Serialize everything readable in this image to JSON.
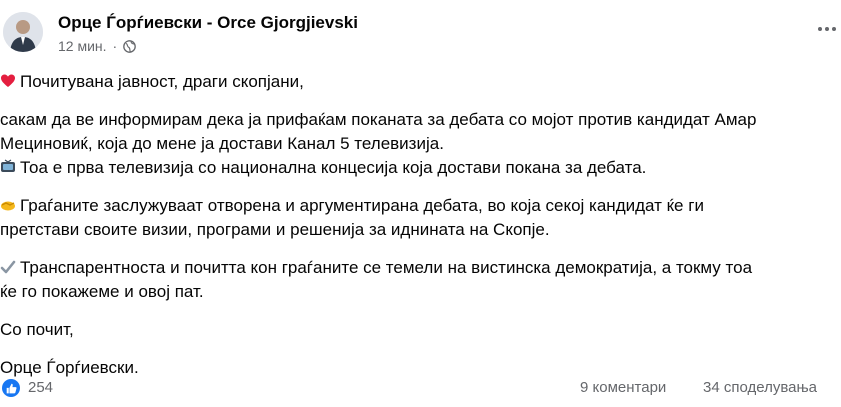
{
  "post": {
    "author": "Орце Ѓорѓиевски - Orce Gjorgjievski",
    "time": "12 мин.",
    "privacy_icon": "globe-icon",
    "more_icon": "more-options-icon",
    "body": {
      "p1": "Почитувана јавност, драги скопјани,",
      "p2": "сакам да ве информирам дека ја прифаќам поканата за дебата со мојот против кандидат Амар\nМециновиќ, која до мене ја достави Канал 5 телевизија.",
      "p2b": "Тоа е прва телевизија со национална концесија која достави покана за дебата.",
      "p3": "Граѓаните заслужуваат отворена и аргументирана дебата, во која секој кандидат ќе ги\nпретстави своите визии, програми и решенија за иднината на Скопје.",
      "p4": "Транспарентноста и почитта кон граѓаните се темели на вистинска демократија, а токму тоа\nќе го покажеме и овој пат.",
      "p5": "Со почит,",
      "p6": "Орце Ѓорѓиевски."
    },
    "reactions": {
      "count": "254"
    },
    "comments": "9 коментари",
    "shares": "34 споделувања"
  },
  "colors": {
    "accent": "#1877f2",
    "muted": "#65676b",
    "text": "#050505"
  }
}
